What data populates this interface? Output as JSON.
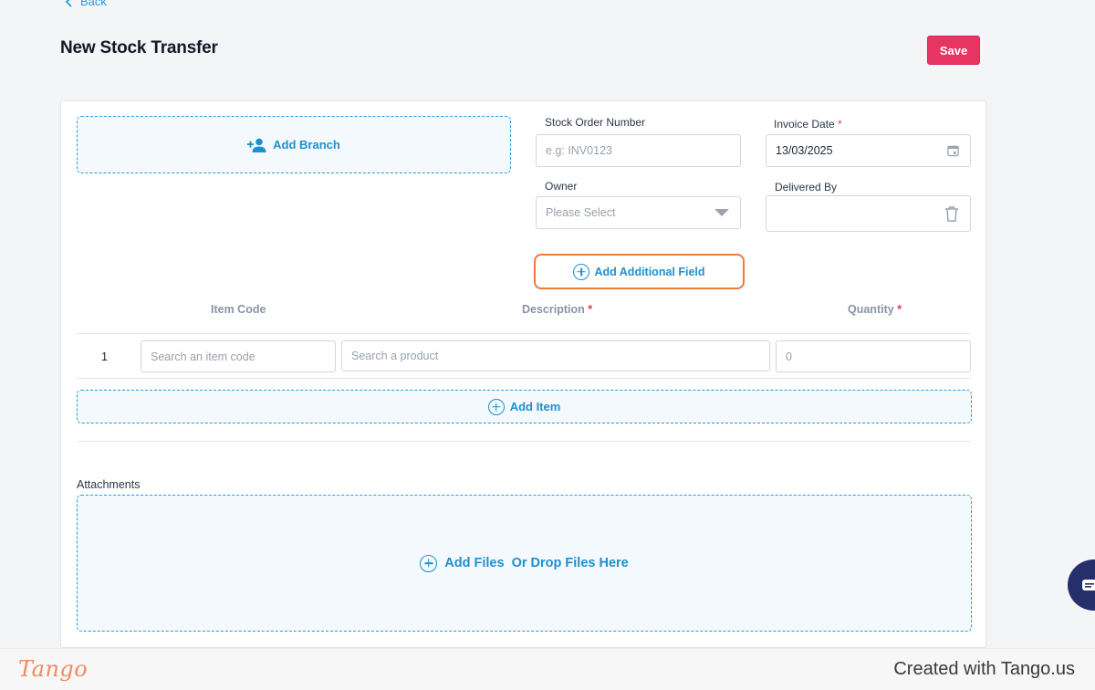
{
  "header": {
    "back_label": "Back",
    "title": "New Stock Transfer",
    "save_label": "Save"
  },
  "form": {
    "add_branch_label": "Add Branch",
    "stock_order_number": {
      "label": "Stock Order Number",
      "placeholder": "e.g: INV0123",
      "value": ""
    },
    "invoice_date": {
      "label": "Invoice Date",
      "required_mark": "*",
      "value": "13/03/2025"
    },
    "owner": {
      "label": "Owner",
      "placeholder": "Please Select"
    },
    "delivered_by": {
      "label": "Delivered By",
      "value": ""
    },
    "add_additional_field_label": "Add Additional Field"
  },
  "items_table": {
    "columns": [
      {
        "label": "Item Code",
        "required_mark": ""
      },
      {
        "label": "Description",
        "required_mark": "*"
      },
      {
        "label": "Quantity",
        "required_mark": "*"
      }
    ],
    "rows": [
      {
        "number": "1",
        "item_code_placeholder": "Search an item code",
        "description_placeholder": "Search a product",
        "quantity_placeholder": "0"
      }
    ],
    "add_item_label": "Add Item"
  },
  "attachments": {
    "label": "Attachments",
    "dropzone_label": "Add Files  Or Drop Files Here"
  },
  "footer": {
    "logo_text": "Tango",
    "created_text": "Created with Tango.us"
  },
  "icons": [
    "chevron-left-icon",
    "add-user-icon",
    "calendar-icon",
    "chevron-down-icon",
    "trash-icon",
    "plus-circle-icon",
    "chat-icon"
  ],
  "colors": {
    "accent": "#1e8fcf",
    "save": "#e83463",
    "highlight": "#f07a3d",
    "required": "#e8344e",
    "chat": "#25306b",
    "tango": "#f08a60"
  }
}
